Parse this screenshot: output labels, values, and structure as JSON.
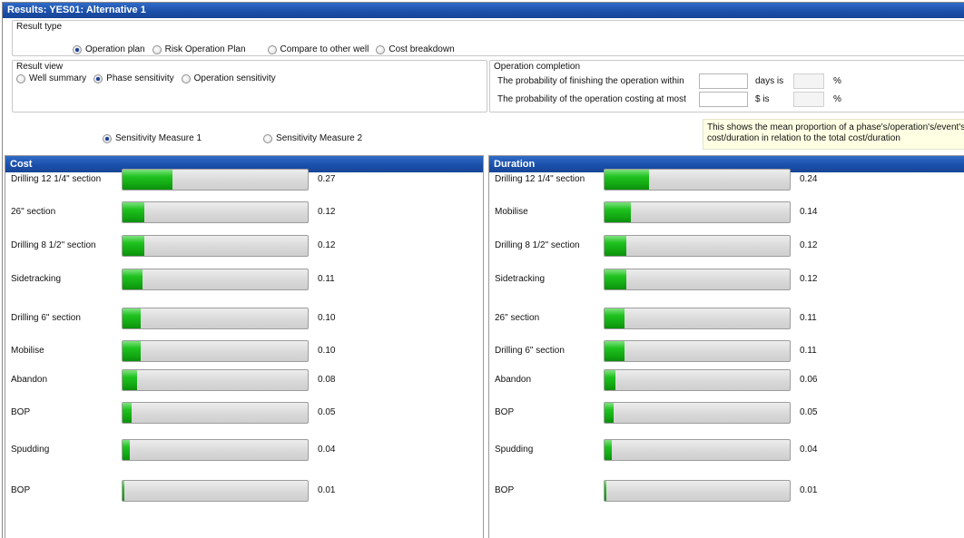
{
  "window": {
    "title": "Results: YES01: Alternative 1"
  },
  "result_type": {
    "label": "Result type",
    "options": [
      {
        "label": "Operation plan",
        "selected": true
      },
      {
        "label": "Risk Operation Plan",
        "selected": false
      },
      {
        "label": "Compare to other well",
        "selected": false
      },
      {
        "label": "Cost breakdown",
        "selected": false
      }
    ]
  },
  "result_view": {
    "label": "Result view",
    "options": [
      {
        "label": "Well summary",
        "selected": false
      },
      {
        "label": "Phase sensitivity",
        "selected": true
      },
      {
        "label": "Operation sensitivity",
        "selected": false
      }
    ]
  },
  "operation_completion": {
    "label": "Operation completion",
    "rows": [
      {
        "text": "The probability of finishing the operation within",
        "input_value": "",
        "unit": "days is",
        "result_value": "",
        "percent": "%"
      },
      {
        "text": "The probability of the operation costing at most",
        "input_value": "",
        "unit": "$ is",
        "result_value": "",
        "percent": "%"
      }
    ]
  },
  "sensitivity": {
    "options": [
      {
        "label": "Sensitivity Measure 1",
        "selected": true
      },
      {
        "label": "Sensitivity Measure 2",
        "selected": false
      }
    ]
  },
  "tooltip": {
    "line1": "This shows the mean proportion of a phase's/operation's/event's",
    "line2": "cost/duration in relation to the total cost/duration"
  },
  "cost_panel": {
    "title": "Cost",
    "rows": [
      {
        "label": "Drilling 12 1/4\" section",
        "value": "0.27",
        "fraction": 0.27
      },
      {
        "label": "26\" section",
        "value": "0.12",
        "fraction": 0.12
      },
      {
        "label": "Drilling 8 1/2\" section",
        "value": "0.12",
        "fraction": 0.12
      },
      {
        "label": "Sidetracking",
        "value": "0.11",
        "fraction": 0.11
      },
      {
        "label": "Drilling 6\" section",
        "value": "0.10",
        "fraction": 0.1
      },
      {
        "label": "Mobilise",
        "value": "0.10",
        "fraction": 0.1
      },
      {
        "label": "Abandon",
        "value": "0.08",
        "fraction": 0.08
      },
      {
        "label": "BOP",
        "value": "0.05",
        "fraction": 0.05
      },
      {
        "label": "Spudding",
        "value": "0.04",
        "fraction": 0.04
      },
      {
        "label": "BOP",
        "value": "0.01",
        "fraction": 0.01
      }
    ]
  },
  "duration_panel": {
    "title": "Duration",
    "rows": [
      {
        "label": "Drilling 12 1/4\" section",
        "value": "0.24",
        "fraction": 0.24
      },
      {
        "label": "Mobilise",
        "value": "0.14",
        "fraction": 0.14
      },
      {
        "label": "Drilling 8 1/2\" section",
        "value": "0.12",
        "fraction": 0.12
      },
      {
        "label": "Sidetracking",
        "value": "0.12",
        "fraction": 0.12
      },
      {
        "label": "26\" section",
        "value": "0.11",
        "fraction": 0.11
      },
      {
        "label": "Drilling 6\" section",
        "value": "0.11",
        "fraction": 0.11
      },
      {
        "label": "Abandon",
        "value": "0.06",
        "fraction": 0.06
      },
      {
        "label": "BOP",
        "value": "0.05",
        "fraction": 0.05
      },
      {
        "label": "Spudding",
        "value": "0.04",
        "fraction": 0.04
      },
      {
        "label": "BOP",
        "value": "0.01",
        "fraction": 0.01
      }
    ]
  },
  "colors": {
    "title_bar": "#1a4ea8",
    "bar_fill": "#12a712",
    "tooltip_bg": "#ffffe4"
  }
}
